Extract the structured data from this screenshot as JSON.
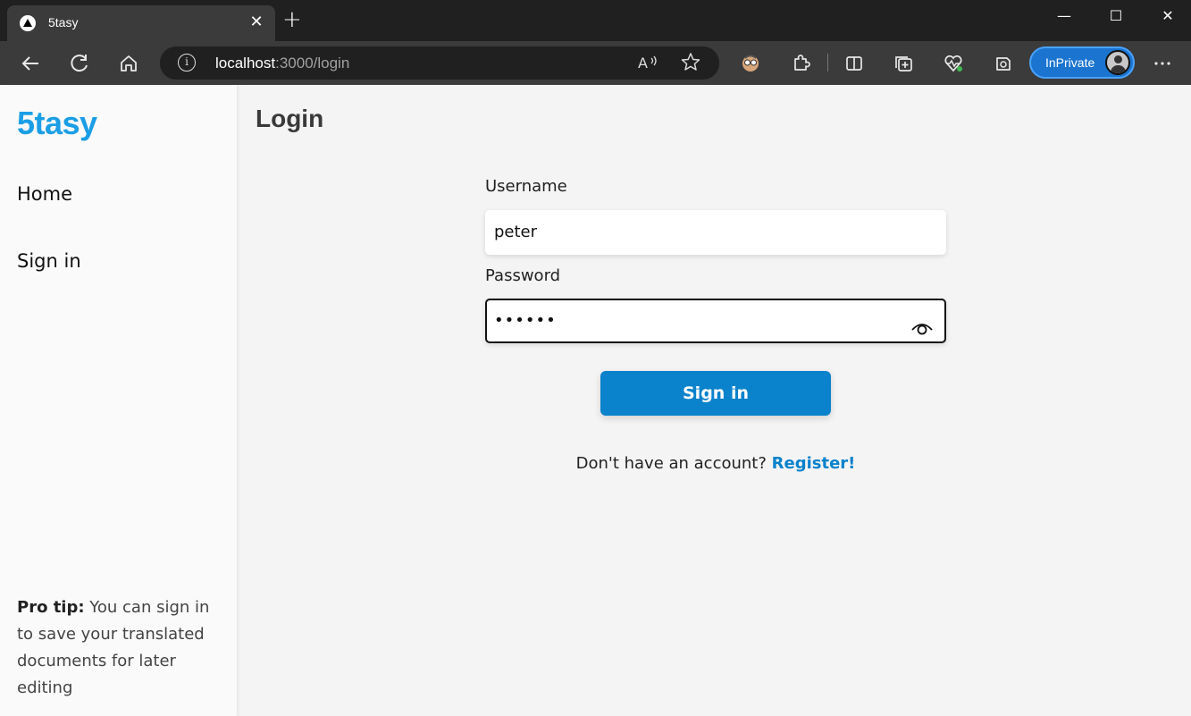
{
  "browser": {
    "tab_title": "5tasy",
    "tab_close": "✕",
    "new_tab": "+",
    "window_controls": {
      "minimize": "—",
      "maximize": "☐",
      "close": "✕"
    },
    "toolbar": {
      "back_icon": "back-arrow-icon",
      "refresh_icon": "refresh-icon",
      "home_icon": "home-icon"
    },
    "address": {
      "host": "localhost",
      "path": ":3000/login"
    },
    "inprivate_label": "InPrivate"
  },
  "sidebar": {
    "brand": "5tasy",
    "nav": [
      {
        "label": "Home"
      },
      {
        "label": "Sign in"
      }
    ],
    "protip_label": "Pro tip:",
    "protip_text": " You can sign in to save your translated documents for later editing"
  },
  "main": {
    "title": "Login",
    "username_label": "Username",
    "username_value": "peter",
    "password_label": "Password",
    "password_masked": "••••••",
    "signin_button": "Sign in",
    "register_prompt": "Don't have an account? ",
    "register_link": "Register!"
  },
  "colors": {
    "brand": "#1b9ee6",
    "primary_button": "#0a82cc",
    "inprivate": "#1a74d0"
  }
}
